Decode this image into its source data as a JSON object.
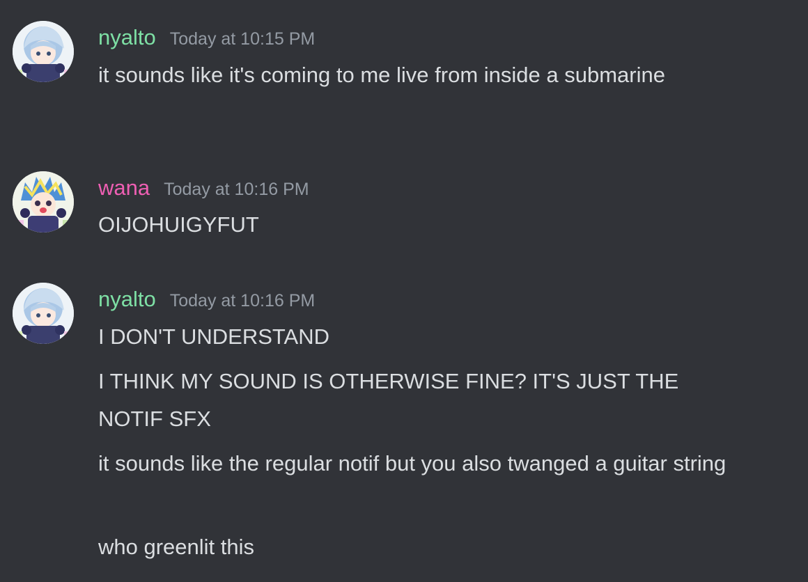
{
  "colors": {
    "background": "#313338",
    "nyalto_name": "#7ee0a5",
    "wana_name": "#ee5fb3",
    "timestamp": "#949ba4",
    "message_text": "#dbdee1"
  },
  "messages": [
    {
      "author": "nyalto",
      "timestamp": "Today at 10:15 PM",
      "lines": [
        "it sounds like it's coming to me live from inside a submarine"
      ]
    },
    {
      "author": "wana",
      "timestamp": "Today at 10:16 PM",
      "lines": [
        "OIJOHUIGYFUT"
      ]
    },
    {
      "author": "nyalto",
      "timestamp": "Today at 10:16 PM",
      "lines": [
        "I DON'T UNDERSTAND",
        "I THINK MY SOUND IS OTHERWISE FINE? IT'S JUST THE NOTIF SFX",
        "it sounds like the regular notif but you also twanged a guitar string",
        "who greenlit this"
      ]
    }
  ]
}
